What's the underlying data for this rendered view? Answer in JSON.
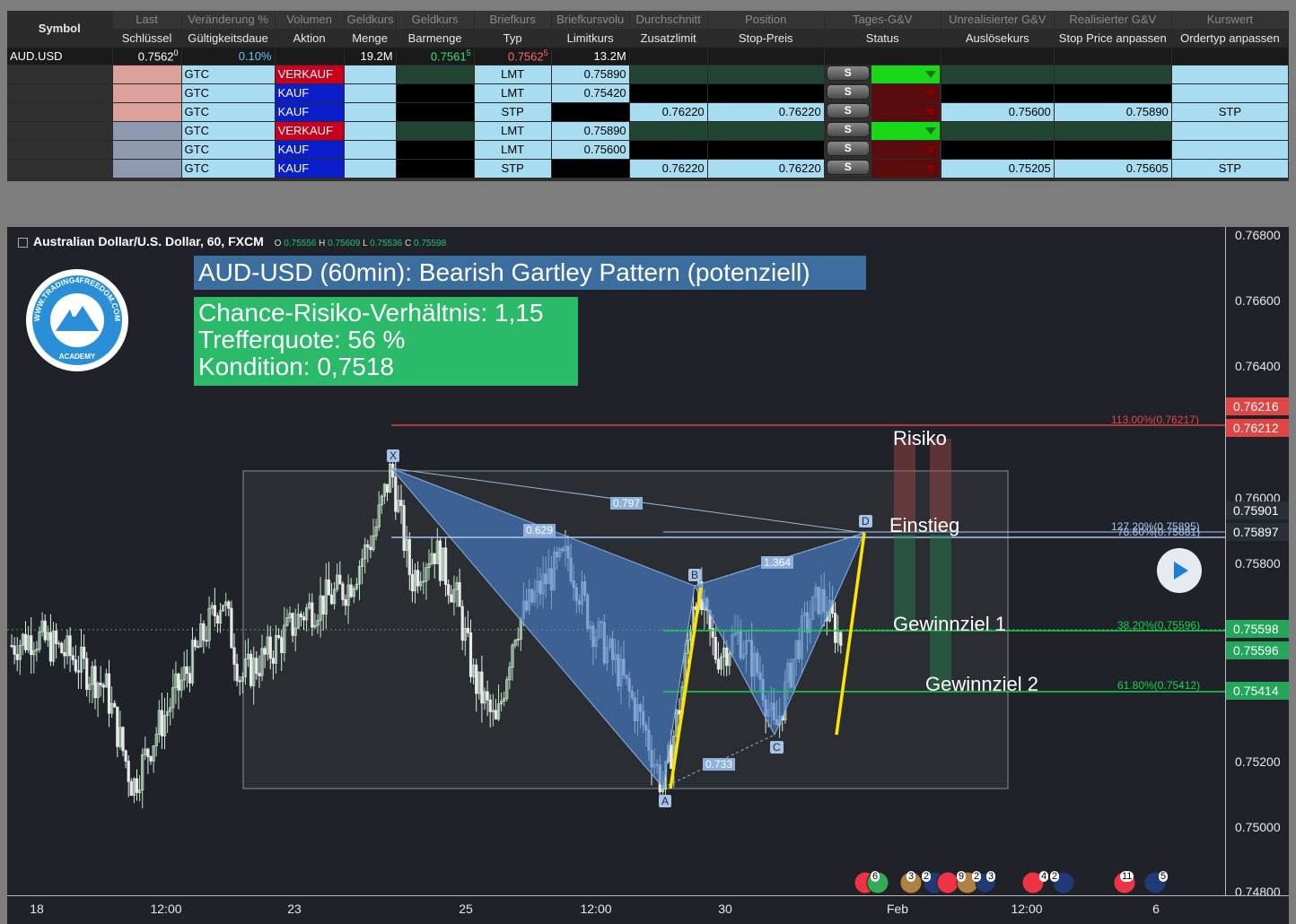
{
  "table": {
    "header1": [
      "",
      "Last",
      "Veränderung %",
      "Volumen",
      "Geldkurs",
      "Geldkurs",
      "Briefkurs",
      "Briefkursvolu",
      "Durchschnitt",
      "Position",
      "Tages-G&V",
      "Unrealisierter G&V",
      "Realisierter G&V",
      "Kurswert"
    ],
    "header2": [
      "Symbol",
      "Schlüssel",
      "Gültigkeitsdaue",
      "Aktion",
      "Menge",
      "Barmenge",
      "Typ",
      "Limitkurs",
      "Zusatzlimit",
      "Stop-Preis",
      "Status",
      "Auslösekurs",
      "Stop Price anpassen",
      "Ordertyp anpassen"
    ],
    "main": {
      "symbol": "AUD.USD",
      "last": "0.7562",
      "last_sup": "0",
      "change": "0.10%",
      "volume": "19.2M",
      "bid": "0.7561",
      "bid_sup": "5",
      "ask": "0.7562",
      "ask_sup": "5",
      "ask_vol": "13.2M"
    },
    "status_button": "S",
    "orders": [
      {
        "tif": "GTC",
        "action": "VERKAUF",
        "type": "LMT",
        "limit": "0.75890",
        "extra_limit": "",
        "stop": "",
        "trigger": "",
        "stop_adjust": "",
        "type_adjust": ""
      },
      {
        "tif": "GTC",
        "action": "KAUF",
        "type": "LMT",
        "limit": "0.75420",
        "extra_limit": "",
        "stop": "",
        "trigger": "",
        "stop_adjust": "",
        "type_adjust": ""
      },
      {
        "tif": "GTC",
        "action": "KAUF",
        "type": "STP",
        "limit": "",
        "extra_limit": "0.76220",
        "stop": "0.76220",
        "trigger": "0.75600",
        "stop_adjust": "0.75890",
        "type_adjust": "STP"
      },
      {
        "tif": "GTC",
        "action": "VERKAUF",
        "type": "LMT",
        "limit": "0.75890",
        "extra_limit": "",
        "stop": "",
        "trigger": "",
        "stop_adjust": "",
        "type_adjust": ""
      },
      {
        "tif": "GTC",
        "action": "KAUF",
        "type": "LMT",
        "limit": "0.75600",
        "extra_limit": "",
        "stop": "",
        "trigger": "",
        "stop_adjust": "",
        "type_adjust": ""
      },
      {
        "tif": "GTC",
        "action": "KAUF",
        "type": "STP",
        "limit": "",
        "extra_limit": "0.76220",
        "stop": "0.76220",
        "trigger": "0.75205",
        "stop_adjust": "0.75605",
        "type_adjust": "STP"
      }
    ]
  },
  "chart": {
    "legend_title": "Australian Dollar/U.S. Dollar, 60, FXCM",
    "ohlc": [
      {
        "k": "O",
        "v": "0.75556"
      },
      {
        "k": "H",
        "v": "0.75609"
      },
      {
        "k": "L",
        "v": "0.75536"
      },
      {
        "k": "C",
        "v": "0.75598"
      }
    ],
    "headline": "AUD-USD (60min): Bearish Gartley Pattern (potenziell)",
    "stats": [
      "Chance-Risiko-Verhältnis: 1,15",
      "Trefferquote: 56 %",
      "Kondition: 0,7518"
    ],
    "logo": {
      "text": "WWW.TRADING4FREEDOM.COM",
      "sub": "ACADEMY"
    },
    "zones": {
      "risk": "Risiko",
      "entry": "Einstieg",
      "target1": "Gewinnziel 1",
      "target2": "Gewinnziel 2"
    },
    "fib_labels": {
      "f113": "113.00%(0.76217)",
      "f127": "127.20%(0.75895)",
      "f786": "78.60%(0.75881)",
      "f382": "38.20%(0.75596)",
      "f618": "61.80%(0.75412)"
    },
    "pattern_points": {
      "X": "X",
      "A": "A",
      "B": "B",
      "C": "C",
      "D": "D"
    },
    "pattern_ratios": {
      "xb": "0.629",
      "xd": "0.797",
      "ac": "0.733",
      "bd": "1.364"
    },
    "price_ticks": [
      "0.76800",
      "0.76600",
      "0.76400",
      "0.76000",
      "0.75800",
      "0.75200",
      "0.75000",
      "0.74800"
    ],
    "price_tags": [
      {
        "text": "0.76216",
        "color": "#e04545"
      },
      {
        "text": "0.76212",
        "color": "#e04545"
      },
      {
        "text": "0.75901",
        "color": "#2a2f36"
      },
      {
        "text": "0.75897",
        "color": "#2a2f36"
      },
      {
        "text": "0.75598",
        "color": "#23a55a"
      },
      {
        "text": "0.75596",
        "color": "#23a55a"
      },
      {
        "text": "0.75414",
        "color": "#23a55a"
      }
    ],
    "time_ticks": [
      "18",
      "12:00",
      "23",
      "25",
      "12:00",
      "30",
      "Feb",
      "12:00",
      "6"
    ],
    "event_counts": [
      "6",
      "3",
      "2",
      "9",
      "2",
      "3",
      "4",
      "2",
      "11",
      "5"
    ]
  },
  "chart_data": {
    "type": "candlestick",
    "title": "AUD-USD (60min): Bearish Gartley Pattern (potenziell)",
    "ylim": [
      0.748,
      0.768
    ],
    "pattern": {
      "name": "Bearish Gartley (potenziell)",
      "points": [
        {
          "label": "X",
          "price": 0.7609
        },
        {
          "label": "A",
          "price": 0.7511
        },
        {
          "label": "B",
          "price": 0.7573
        },
        {
          "label": "C",
          "price": 0.7528
        },
        {
          "label": "D",
          "price": 0.7589
        }
      ],
      "ratios": {
        "XB": 0.629,
        "XD": 0.797,
        "AC": 0.733,
        "BD": 1.364
      }
    },
    "levels": [
      {
        "name": "Risiko (113.00%)",
        "price": 0.76217
      },
      {
        "name": "Einstieg (127.20%)",
        "price": 0.75895
      },
      {
        "name": "78.60%",
        "price": 0.75881
      },
      {
        "name": "Gewinnziel 1 (38.20%)",
        "price": 0.75596
      },
      {
        "name": "Gewinnziel 2 (61.80%)",
        "price": 0.75412
      }
    ],
    "last_price": 0.75598,
    "ohlc_last": {
      "open": 0.75556,
      "high": 0.75609,
      "low": 0.75536,
      "close": 0.75598
    }
  },
  "colors": {
    "bull": "#bfe3c4",
    "bear": "#e9e9ea",
    "pattern": "#4a7dc8",
    "fib_red": "#e04545",
    "fib_green": "#19d24a"
  }
}
